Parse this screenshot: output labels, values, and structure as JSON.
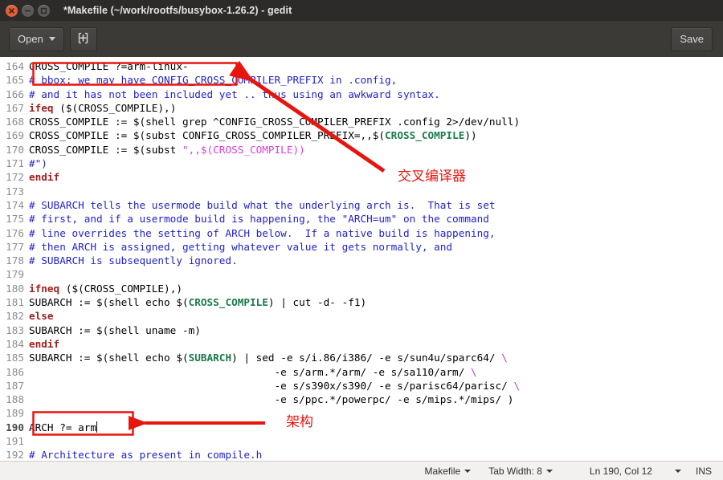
{
  "window": {
    "title": "*Makefile (~/work/rootfs/busybox-1.26.2) - gedit",
    "buttons": {
      "close": "close-button",
      "minimize": "minimize-button",
      "maximize": "maximize-button"
    }
  },
  "toolbar": {
    "open_label": "Open",
    "new_tab_icon": "new-document-icon",
    "save_label": "Save"
  },
  "annotations": {
    "accent_color": "#e8150f",
    "cross_compiler_label": "交叉编译器",
    "arch_label": "架构"
  },
  "statusbar": {
    "language": "Makefile",
    "tab_width": "Tab Width: 8",
    "position": "Ln 190, Col 12",
    "insert_mode": "INS"
  },
  "editor": {
    "first_line": 164,
    "cursor_line": 190,
    "lines": [
      {
        "n": 164,
        "spans": [
          {
            "c": "txt",
            "t": "CROSS_COMPILE ?=arm-linux-"
          }
        ]
      },
      {
        "n": 165,
        "spans": [
          {
            "c": "cmt",
            "t": "# bbox: we may have CONFIG_CROSS_COMPILER_PREFIX in .config,"
          }
        ]
      },
      {
        "n": 166,
        "spans": [
          {
            "c": "cmt",
            "t": "# and it has not been included yet .. thus using an awkward syntax."
          }
        ]
      },
      {
        "n": 167,
        "spans": [
          {
            "c": "kw",
            "t": "ifeq"
          },
          {
            "c": "txt",
            "t": " ($(CROSS_COMPILE),)"
          }
        ]
      },
      {
        "n": 168,
        "spans": [
          {
            "c": "txt",
            "t": "CROSS_COMPILE := $(shell grep ^CONFIG_CROSS_COMPILER_PREFIX .config 2>/dev/null)"
          }
        ]
      },
      {
        "n": 169,
        "spans": [
          {
            "c": "txt",
            "t": "CROSS_COMPILE := $(subst CONFIG_CROSS_COMPILER_PREFIX=,,$("
          },
          {
            "c": "var",
            "t": "CROSS_COMPILE"
          },
          {
            "c": "txt",
            "t": "))"
          }
        ]
      },
      {
        "n": 170,
        "spans": [
          {
            "c": "txt",
            "t": "CROSS_COMPILE := $(subst "
          },
          {
            "c": "str",
            "t": "\",,$(CROSS_COMPILE))"
          }
        ]
      },
      {
        "n": 171,
        "spans": [
          {
            "c": "cmt",
            "t": "#\")"
          }
        ]
      },
      {
        "n": 172,
        "spans": [
          {
            "c": "kw",
            "t": "endif"
          }
        ]
      },
      {
        "n": 173,
        "spans": []
      },
      {
        "n": 174,
        "spans": [
          {
            "c": "cmt",
            "t": "# SUBARCH tells the usermode build what the underlying arch is.  That is set"
          }
        ]
      },
      {
        "n": 175,
        "spans": [
          {
            "c": "cmt",
            "t": "# first, and if a usermode build is happening, the \"ARCH=um\" on the command"
          }
        ]
      },
      {
        "n": 176,
        "spans": [
          {
            "c": "cmt",
            "t": "# line overrides the setting of ARCH below.  If a native build is happening,"
          }
        ]
      },
      {
        "n": 177,
        "spans": [
          {
            "c": "cmt",
            "t": "# then ARCH is assigned, getting whatever value it gets normally, and"
          }
        ]
      },
      {
        "n": 178,
        "spans": [
          {
            "c": "cmt",
            "t": "# SUBARCH is subsequently ignored."
          }
        ]
      },
      {
        "n": 179,
        "spans": []
      },
      {
        "n": 180,
        "spans": [
          {
            "c": "kw",
            "t": "ifneq"
          },
          {
            "c": "txt",
            "t": " ($(CROSS_COMPILE),)"
          }
        ]
      },
      {
        "n": 181,
        "spans": [
          {
            "c": "txt",
            "t": "SUBARCH := $(shell echo $("
          },
          {
            "c": "var",
            "t": "CROSS_COMPILE"
          },
          {
            "c": "txt",
            "t": ") | cut -d- -f1)"
          }
        ]
      },
      {
        "n": 182,
        "spans": [
          {
            "c": "kw",
            "t": "else"
          }
        ]
      },
      {
        "n": 183,
        "spans": [
          {
            "c": "txt",
            "t": "SUBARCH := $(shell uname -m)"
          }
        ]
      },
      {
        "n": 184,
        "spans": [
          {
            "c": "kw",
            "t": "endif"
          }
        ]
      },
      {
        "n": 185,
        "spans": [
          {
            "c": "txt",
            "t": "SUBARCH := $(shell echo $("
          },
          {
            "c": "var",
            "t": "SUBARCH"
          },
          {
            "c": "txt",
            "t": ") | sed -e s/i.86/i386/ -e s/sun4u/sparc64/ "
          },
          {
            "c": "esc",
            "t": "\\"
          }
        ]
      },
      {
        "n": 186,
        "spans": [
          {
            "c": "txt",
            "t": "                                        -e s/arm.*/arm/ -e s/sa110/arm/ "
          },
          {
            "c": "esc",
            "t": "\\"
          }
        ]
      },
      {
        "n": 187,
        "spans": [
          {
            "c": "txt",
            "t": "                                        -e s/s390x/s390/ -e s/parisc64/parisc/ "
          },
          {
            "c": "esc",
            "t": "\\"
          }
        ]
      },
      {
        "n": 188,
        "spans": [
          {
            "c": "txt",
            "t": "                                        -e s/ppc.*/powerpc/ -e s/mips.*/mips/ )"
          }
        ]
      },
      {
        "n": 189,
        "spans": []
      },
      {
        "n": 190,
        "spans": [
          {
            "c": "txt",
            "t": "ARCH ?= arm"
          }
        ]
      },
      {
        "n": 191,
        "spans": []
      },
      {
        "n": 192,
        "spans": [
          {
            "c": "cmt",
            "t": "# Architecture as present in compile.h"
          }
        ]
      }
    ]
  }
}
